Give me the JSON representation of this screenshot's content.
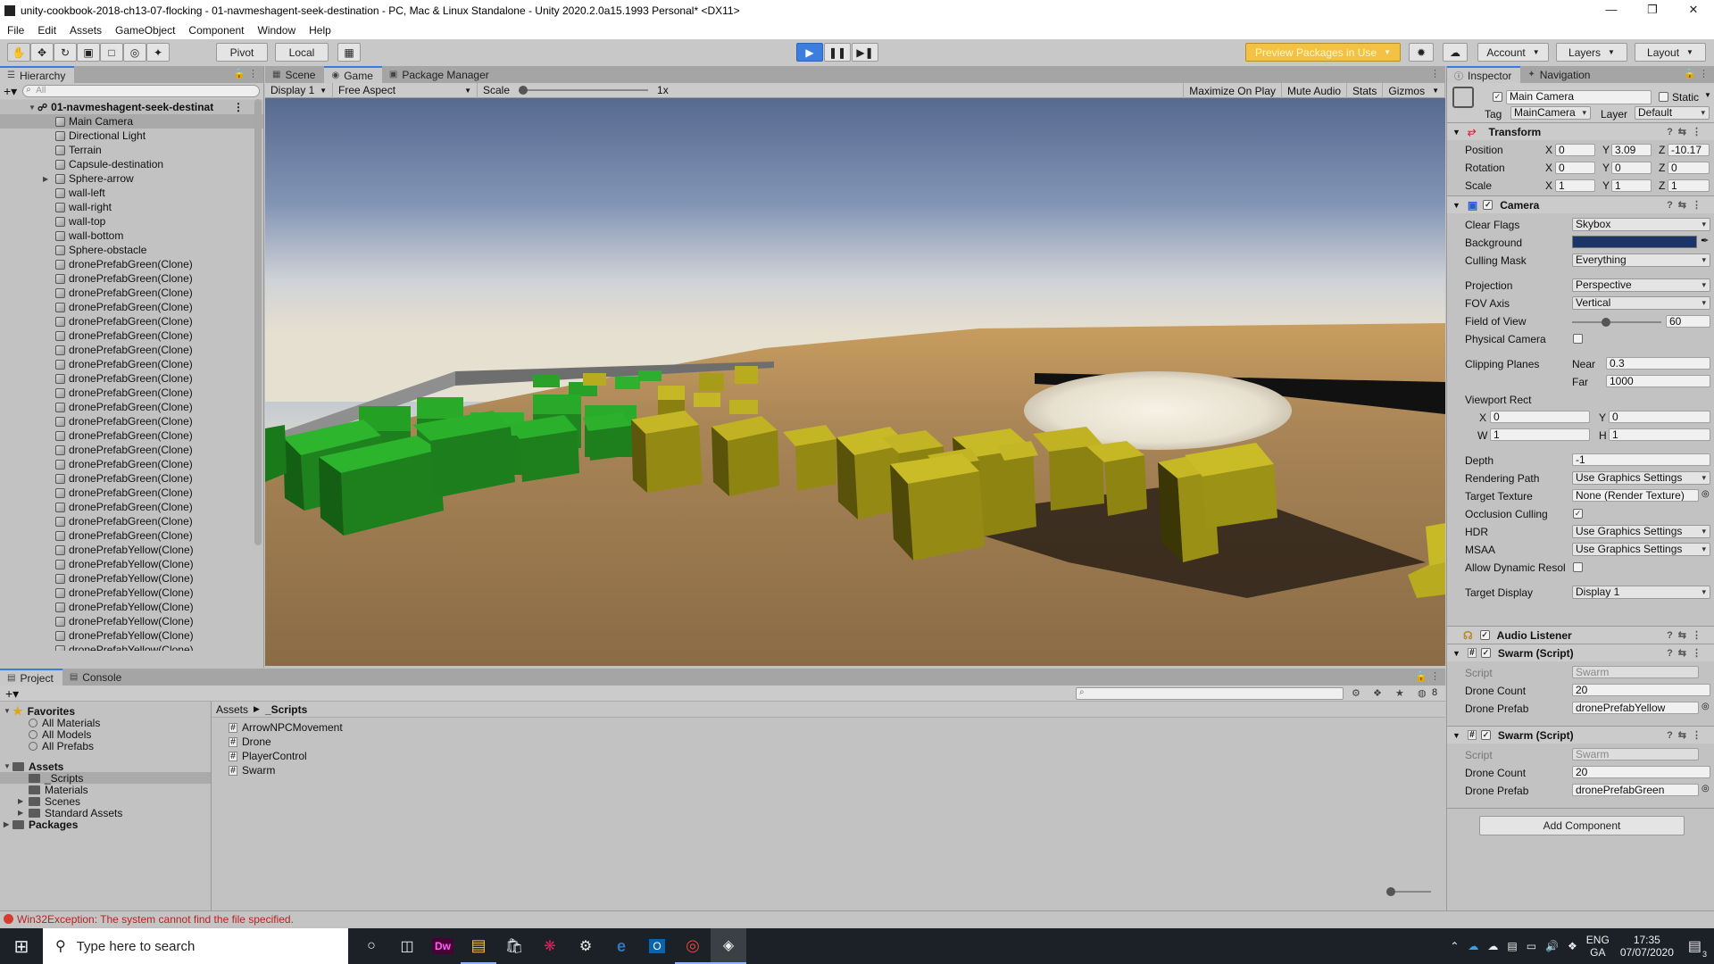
{
  "window": {
    "title": "unity-cookbook-2018-ch13-07-flocking - 01-navmeshagent-seek-destination - PC, Mac & Linux Standalone - Unity 2020.2.0a15.1993 Personal* <DX11>"
  },
  "menu": [
    "File",
    "Edit",
    "Assets",
    "GameObject",
    "Component",
    "Window",
    "Help"
  ],
  "toolbar": {
    "pivot": "Pivot",
    "local": "Local",
    "preview_packages": "Preview Packages in Use",
    "account": "Account",
    "layers": "Layers",
    "layout": "Layout"
  },
  "hierarchy": {
    "tab": "Hierarchy",
    "search_placeholder": "All",
    "scene": "01-navmeshagent-seek-destinat",
    "items": [
      "Main Camera",
      "Directional Light",
      "Terrain",
      "Capsule-destination",
      "Sphere-arrow",
      "wall-left",
      "wall-right",
      "wall-top",
      "wall-bottom",
      "Sphere-obstacle",
      "dronePrefabGreen(Clone)",
      "dronePrefabGreen(Clone)",
      "dronePrefabGreen(Clone)",
      "dronePrefabGreen(Clone)",
      "dronePrefabGreen(Clone)",
      "dronePrefabGreen(Clone)",
      "dronePrefabGreen(Clone)",
      "dronePrefabGreen(Clone)",
      "dronePrefabGreen(Clone)",
      "dronePrefabGreen(Clone)",
      "dronePrefabGreen(Clone)",
      "dronePrefabGreen(Clone)",
      "dronePrefabGreen(Clone)",
      "dronePrefabGreen(Clone)",
      "dronePrefabGreen(Clone)",
      "dronePrefabGreen(Clone)",
      "dronePrefabGreen(Clone)",
      "dronePrefabGreen(Clone)",
      "dronePrefabGreen(Clone)",
      "dronePrefabGreen(Clone)",
      "dronePrefabYellow(Clone)",
      "dronePrefabYellow(Clone)",
      "dronePrefabYellow(Clone)",
      "dronePrefabYellow(Clone)",
      "dronePrefabYellow(Clone)",
      "dronePrefabYellow(Clone)",
      "dronePrefabYellow(Clone)",
      "dronePrefabYellow(Clone)"
    ]
  },
  "center_tabs": {
    "scene": "Scene",
    "game": "Game",
    "package_manager": "Package Manager"
  },
  "gamebar": {
    "display": "Display 1",
    "aspect": "Free Aspect",
    "scale_label": "Scale",
    "scale_value": "1x",
    "maximize": "Maximize On Play",
    "mute": "Mute Audio",
    "stats": "Stats",
    "gizmos": "Gizmos"
  },
  "inspector": {
    "tab": "Inspector",
    "nav_tab": "Navigation",
    "object_name": "Main Camera",
    "static": "Static",
    "tag_label": "Tag",
    "tag": "MainCamera",
    "layer_label": "Layer",
    "layer": "Default",
    "transform": {
      "title": "Transform",
      "position_label": "Position",
      "px": "0",
      "py": "3.09",
      "pz": "-10.17",
      "rotation_label": "Rotation",
      "rx": "0",
      "ry": "0",
      "rz": "0",
      "scale_label": "Scale",
      "sx": "1",
      "sy": "1",
      "sz": "1"
    },
    "camera": {
      "title": "Camera",
      "clear_flags_label": "Clear Flags",
      "clear_flags": "Skybox",
      "background_label": "Background",
      "background_color": "#1b3568",
      "culling_label": "Culling Mask",
      "culling": "Everything",
      "projection_label": "Projection",
      "projection": "Perspective",
      "fov_axis_label": "FOV Axis",
      "fov_axis": "Vertical",
      "fov_label": "Field of View",
      "fov": "60",
      "physical_label": "Physical Camera",
      "clipping_label": "Clipping Planes",
      "near_label": "Near",
      "near": "0.3",
      "far_label": "Far",
      "far": "1000",
      "viewport_label": "Viewport Rect",
      "vx": "0",
      "vy": "0",
      "vw": "1",
      "vh": "1",
      "depth_label": "Depth",
      "depth": "-1",
      "rendering_label": "Rendering Path",
      "rendering": "Use Graphics Settings",
      "target_tex_label": "Target Texture",
      "target_tex": "None (Render Texture)",
      "occlusion_label": "Occlusion Culling",
      "hdr_label": "HDR",
      "hdr": "Use Graphics Settings",
      "msaa_label": "MSAA",
      "msaa": "Use Graphics Settings",
      "dynres_label": "Allow Dynamic Resol",
      "target_display_label": "Target Display",
      "target_display": "Display 1"
    },
    "audio_listener": "Audio Listener",
    "swarm1": {
      "title": "Swarm (Script)",
      "script_label": "Script",
      "script": "Swarm",
      "count_label": "Drone Count",
      "count": "20",
      "prefab_label": "Drone Prefab",
      "prefab": "dronePrefabYellow"
    },
    "swarm2": {
      "title": "Swarm (Script)",
      "script_label": "Script",
      "script": "Swarm",
      "count_label": "Drone Count",
      "count": "20",
      "prefab_label": "Drone Prefab",
      "prefab": "dronePrefabGreen"
    },
    "add_component": "Add Component"
  },
  "project": {
    "tab": "Project",
    "console_tab": "Console",
    "favorites": "Favorites",
    "fav_items": [
      "All Materials",
      "All Models",
      "All Prefabs"
    ],
    "assets": "Assets",
    "asset_items": [
      "_Scripts",
      "Materials",
      "Scenes",
      "Standard Assets"
    ],
    "packages": "Packages",
    "breadcrumb_root": "Assets",
    "breadcrumb_current": "_Scripts",
    "files": [
      "ArrowNPCMovement",
      "Drone",
      "PlayerControl",
      "Swarm"
    ],
    "hidden_count": "8"
  },
  "status": {
    "error": "Win32Exception: The system cannot find the file specified."
  },
  "taskbar": {
    "search": "Type here to search",
    "lang": "ENG",
    "region": "GA",
    "time": "17:35",
    "date": "07/07/2020",
    "notifications": "3"
  }
}
